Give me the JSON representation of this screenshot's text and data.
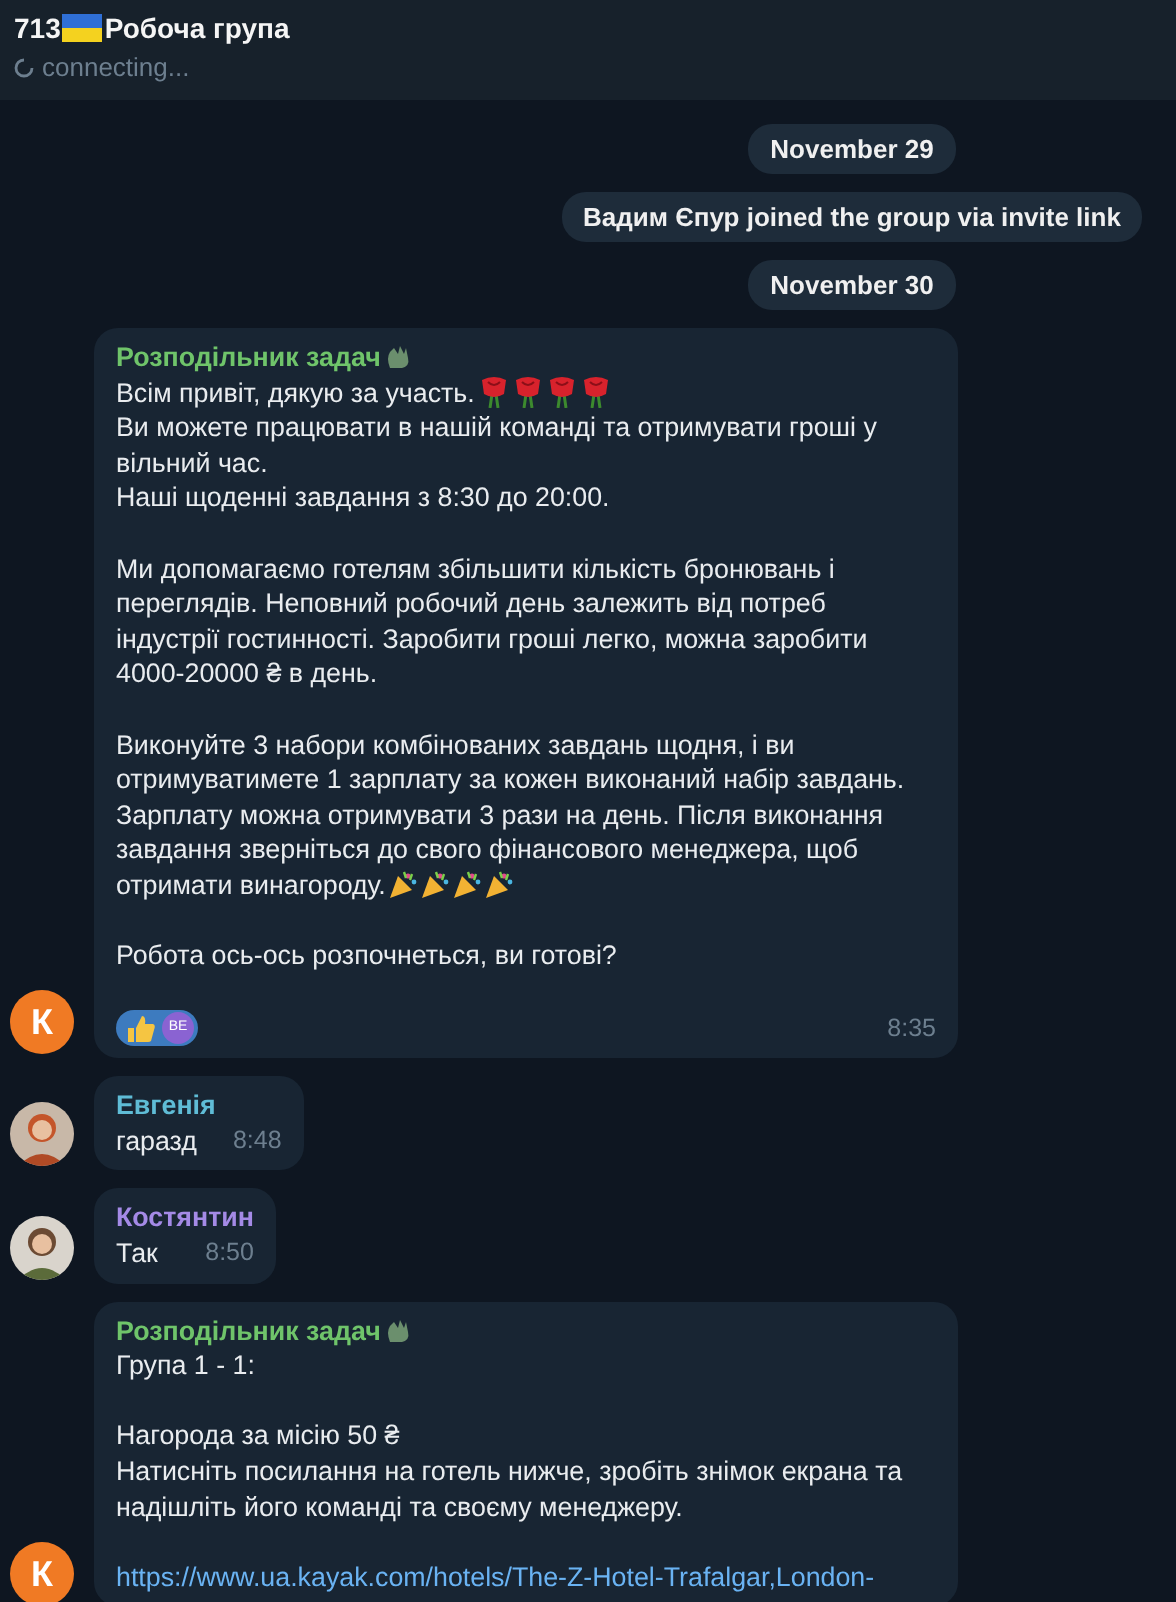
{
  "header": {
    "count": "713",
    "title": "Робоча група",
    "status": "connecting..."
  },
  "messages": [
    {
      "kind": "service",
      "text": "November 29"
    },
    {
      "kind": "service",
      "text": "Вадим Єпур joined the group via invite link"
    },
    {
      "kind": "service",
      "text": "November 30"
    },
    {
      "kind": "post",
      "sender": "Розподільник задач",
      "color": "#6fc46a",
      "avatar": {
        "kind": "letter",
        "letter": "К"
      },
      "paragraphs": [
        [
          {
            "kind": "roses",
            "text": "Всім привіт, дякую за участь."
          },
          {
            "kind": "text",
            "text": "Ви можете працювати в нашій команді та отримувати гроші у"
          },
          {
            "kind": "text",
            "text": "вільний час."
          },
          {
            "kind": "text",
            "text": "Наші щоденні завдання з 8:30 до 20:00."
          }
        ],
        [
          {
            "kind": "text",
            "text": "Ми допомагаємо готелям збільшити кількість бронювань і"
          },
          {
            "kind": "text",
            "text": "переглядів. Неповний робочий день залежить від потреб"
          },
          {
            "kind": "text",
            "text": "індустрії гостинності. Заробити гроші легко, можна заробити"
          },
          {
            "kind": "text",
            "text": "4000-20000 ₴ в день."
          }
        ],
        [
          {
            "kind": "text",
            "text": "Виконуйте 3 набори комбінованих завдань щодня, і ви"
          },
          {
            "kind": "text",
            "text": "отримуватимете 1 зарплату за кожен виконаний набір завдань."
          },
          {
            "kind": "text",
            "text": "Зарплату можна отримувати 3 рази на день. Після виконання"
          },
          {
            "kind": "text",
            "text": "завдання зверніться до свого фінансового менеджера, щоб"
          },
          {
            "kind": "party",
            "text": "отримати винагороду."
          }
        ],
        [
          {
            "kind": "text",
            "text": "Робота ось-ось розпочнеться, ви готові?"
          }
        ]
      ],
      "reaction": {
        "initials": "ВЕ"
      },
      "time": "8:35"
    },
    {
      "kind": "post",
      "sender": "Евгенія",
      "color": "#5fbcd6",
      "paragraphs": [
        [
          {
            "kind": "text",
            "text": "гаразд"
          }
        ]
      ],
      "time": "8:48"
    },
    {
      "kind": "post",
      "sender": "Костянтин",
      "color": "#a48ae6",
      "paragraphs": [
        [
          {
            "kind": "text",
            "text": "Так"
          }
        ]
      ],
      "time": "8:50"
    },
    {
      "kind": "post",
      "sender": "Розподільник задач",
      "color": "#6fc46a",
      "avatar": {
        "kind": "letter",
        "letter": "К"
      },
      "paragraphs": [
        [
          {
            "kind": "text",
            "text": "Група 1 - 1:"
          }
        ],
        [
          {
            "kind": "text",
            "text": "Нагорода за місію 50 ₴"
          },
          {
            "kind": "text",
            "text": "Натисніть посилання на готель нижче, зробіть знімок екрана та"
          },
          {
            "kind": "text",
            "text": "надішліть його команді та своєму менеджеру."
          }
        ],
        [
          {
            "kind": "link",
            "text": "https://www.ua.kayak.com/hotels/The-Z-Hotel-Trafalgar,London-"
          }
        ]
      ]
    }
  ]
}
